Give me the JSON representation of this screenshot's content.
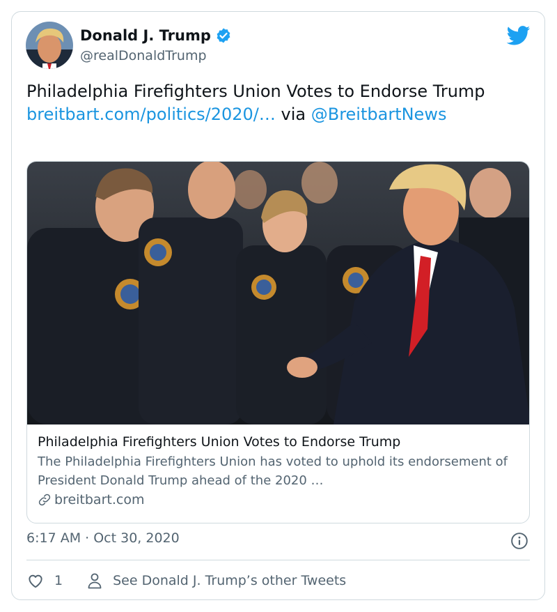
{
  "author": {
    "name": "Donald J. Trump",
    "handle": "@realDonaldTrump",
    "verified": true,
    "avatar_icon": "avatar-photo"
  },
  "tweet": {
    "text_1": "Philadelphia Firefighters Union Votes to Endorse Trump ",
    "link": "breitbart.com/politics/2020/…",
    "text_2": " via ",
    "mention": "@BreitbartNews"
  },
  "link_card": {
    "title": "Philadelphia Firefighters Union Votes to Endorse Trump",
    "description": "The Philadelphia Firefighters Union has voted to uphold its endorsement of President Donald Trump ahead of the 2020 …",
    "domain": "breitbart.com"
  },
  "meta": {
    "timestamp": "6:17 AM · Oct 30, 2020"
  },
  "actions": {
    "like_count": "1",
    "other_tweets_label": "See Donald J. Trump’s other Tweets"
  },
  "colors": {
    "link": "#1b95e0",
    "muted": "#536471",
    "border": "#cfd9de",
    "twitter_blue": "#1da1f2"
  }
}
